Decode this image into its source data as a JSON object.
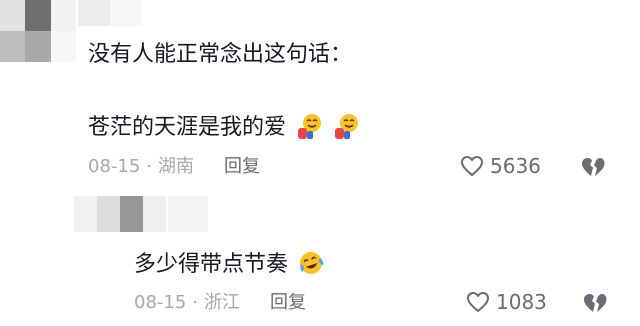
{
  "comments": [
    {
      "text_line1": "没有人能正常念出这句话：",
      "text_line2": "苍茫的天涯是我的爱",
      "emojis": [
        "bowing-laugh-emoji",
        "bowing-laugh-emoji"
      ],
      "date": "08-15",
      "separator": "·",
      "location": "湖南",
      "reply_label": "回复",
      "likes": "5636",
      "icons": {
        "like": "heart-outline-icon",
        "dislike": "broken-heart-icon"
      }
    },
    {
      "text_line1": "多少得带点节奏",
      "emojis": [
        "tears-of-joy-emoji"
      ],
      "date": "08-15",
      "separator": "·",
      "location": "浙江",
      "reply_label": "回复",
      "likes": "1083",
      "icons": {
        "like": "heart-outline-icon",
        "dislike": "broken-heart-icon"
      }
    }
  ],
  "colors": {
    "text": "#161823",
    "meta": "#a7a8ad",
    "action": "#6b6c72",
    "emoji_face": "#f9c22b"
  }
}
